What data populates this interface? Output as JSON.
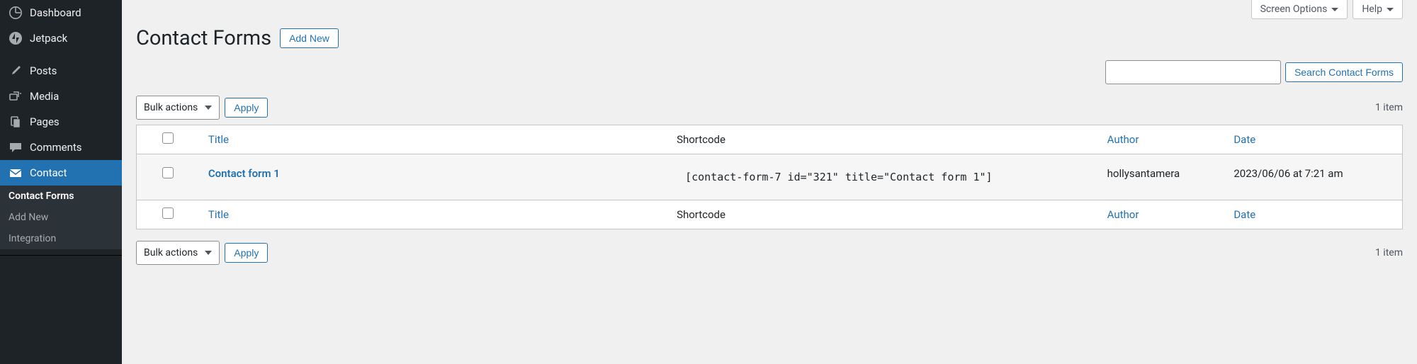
{
  "top": {
    "screen_options": "Screen Options",
    "help": "Help"
  },
  "header": {
    "title": "Contact Forms",
    "add_new": "Add New"
  },
  "search": {
    "button": "Search Contact Forms"
  },
  "bulk": {
    "label": "Bulk actions",
    "apply": "Apply"
  },
  "count": {
    "text": "1 item"
  },
  "sidebar": {
    "items": [
      {
        "label": "Dashboard",
        "icon": "dashboard"
      },
      {
        "label": "Jetpack",
        "icon": "jetpack"
      },
      {
        "label": "Posts",
        "icon": "posts"
      },
      {
        "label": "Media",
        "icon": "media"
      },
      {
        "label": "Pages",
        "icon": "pages"
      },
      {
        "label": "Comments",
        "icon": "comments"
      },
      {
        "label": "Contact",
        "icon": "contact"
      }
    ],
    "submenu": [
      {
        "label": "Contact Forms",
        "current": true
      },
      {
        "label": "Add New",
        "current": false
      },
      {
        "label": "Integration",
        "current": false
      }
    ]
  },
  "table": {
    "headers": {
      "title": "Title",
      "shortcode": "Shortcode",
      "author": "Author",
      "date": "Date"
    },
    "rows": [
      {
        "title": "Contact form 1",
        "shortcode": "[contact-form-7 id=\"321\" title=\"Contact form 1\"]",
        "author": "hollysantamera",
        "date": "2023/06/06 at 7:21 am"
      }
    ]
  }
}
